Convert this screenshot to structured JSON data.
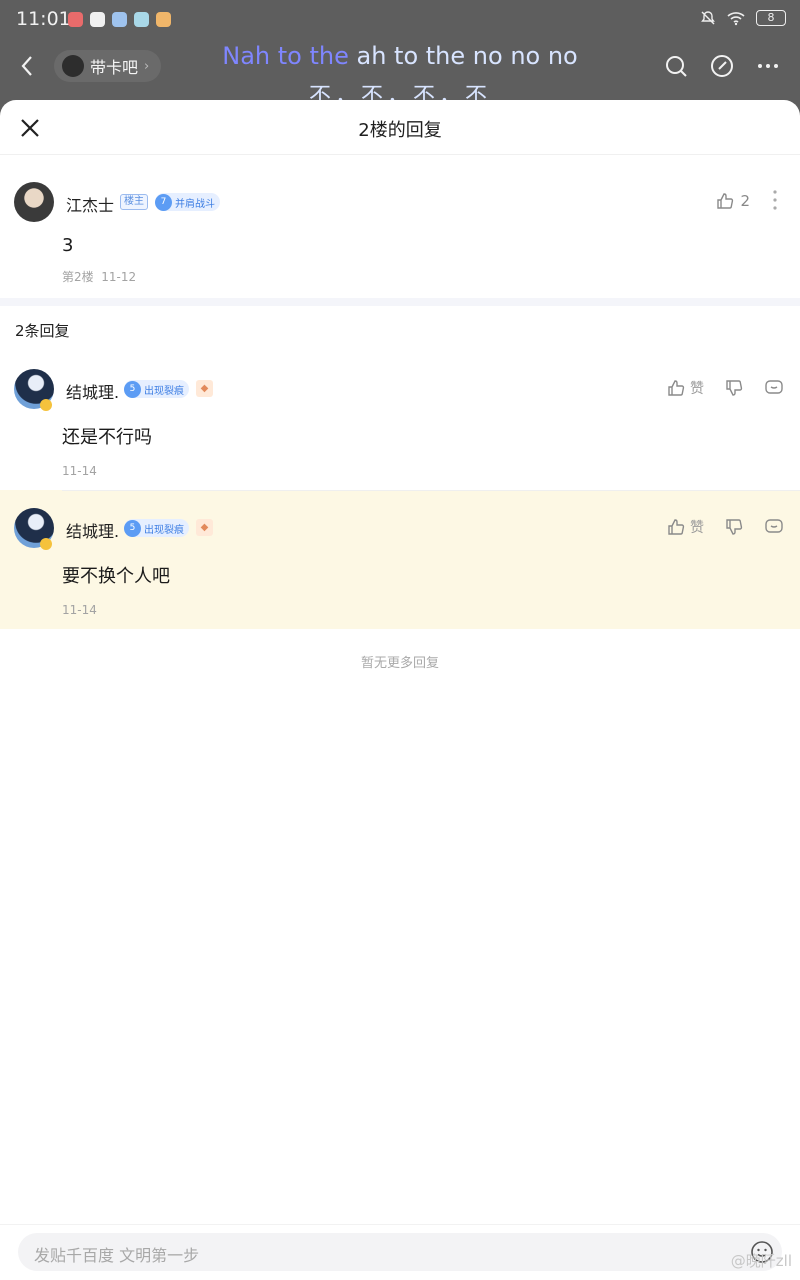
{
  "status_bar": {
    "time": "11:01",
    "battery": "8"
  },
  "nav": {
    "forum_name": "带卡吧"
  },
  "lyrics": {
    "line1_highlight": "Nah to the",
    "line1_rest": " ah to the no no no",
    "line2": "不，不，不，不"
  },
  "sheet": {
    "title": "2楼的回复"
  },
  "main_post": {
    "author": "江杰士",
    "badge": "楼主",
    "level": "7",
    "level_title": "并肩战斗",
    "content": "3",
    "floor": "第2楼",
    "date": "11-12",
    "likes": "2"
  },
  "reply_count": "2条回复",
  "replies": [
    {
      "author": "结城理.",
      "level": "5",
      "level_title": "出现裂痕",
      "content": "还是不行吗",
      "date": "11-14",
      "like_label": "赞"
    },
    {
      "author": "结城理.",
      "level": "5",
      "level_title": "出现裂痕",
      "content": "要不换个人吧",
      "date": "11-14",
      "like_label": "赞"
    }
  ],
  "no_more_text": "暂无更多回复",
  "compose": {
    "placeholder": "发贴千百度 文明第一步"
  },
  "watermark": "@晚阡zll",
  "colors": {
    "accent": "#5c9cf4",
    "highlight_row": "#fdf8e4",
    "dim_overlay": "#5e5e5e"
  }
}
